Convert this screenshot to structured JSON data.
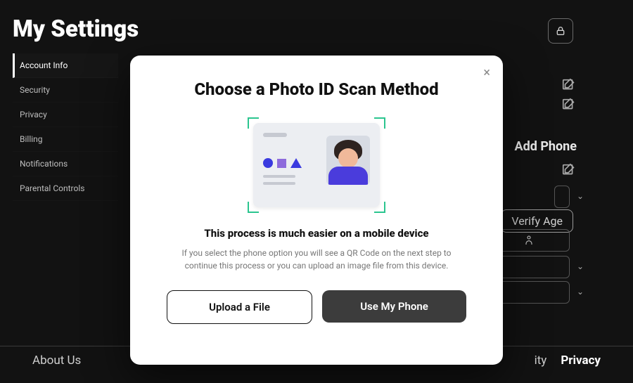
{
  "header": {
    "title": "My Settings"
  },
  "sidebar": {
    "items": [
      {
        "label": "Account Info",
        "active": true
      },
      {
        "label": "Security"
      },
      {
        "label": "Privacy"
      },
      {
        "label": "Billing"
      },
      {
        "label": "Notifications"
      },
      {
        "label": "Parental Controls"
      }
    ]
  },
  "right_panel": {
    "add_phone_label": "Add Phone",
    "verify_age_label": "Verify Age"
  },
  "footer": {
    "left": "About Us",
    "right_partial": "ity",
    "right": "Privacy"
  },
  "modal": {
    "title": "Choose a Photo ID Scan Method",
    "subheading": "This process is much easier on a mobile device",
    "description": "If you select the phone option you will see a QR Code on the next step to continue this process or you can upload an image file from this device.",
    "upload_label": "Upload a File",
    "phone_label": "Use My Phone",
    "close_glyph": "×"
  },
  "icons": {
    "lock": "lock-icon",
    "edit": "edit-icon",
    "chevron_down": "chevron-down-icon",
    "person": "person-figure-icon"
  }
}
